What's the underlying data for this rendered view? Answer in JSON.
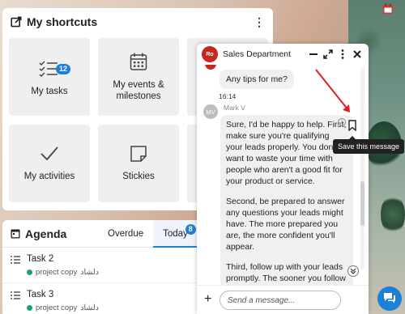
{
  "shortcuts": {
    "title": "My shortcuts",
    "menu": "⋮",
    "tiles": [
      {
        "label": "My tasks",
        "icon": "tasks-checklist-icon",
        "badge": "12"
      },
      {
        "label": "My events &\nmilestones",
        "icon": "calendar-icon"
      },
      {
        "label": "My activities",
        "icon": "checkmark-icon"
      },
      {
        "label": "Stickies",
        "icon": "sticky-note-icon"
      }
    ]
  },
  "agenda": {
    "title": "Agenda",
    "tabs": [
      {
        "label": "Overdue"
      },
      {
        "label": "Today",
        "badge": "8"
      }
    ],
    "items": [
      {
        "name": "Task 2",
        "project": "project copy",
        "owner": "دلشاد"
      },
      {
        "name": "Task 3",
        "project": "project copy",
        "owner": "دلشاد"
      }
    ]
  },
  "chat": {
    "title": "Sales Department",
    "avatar": "Ro",
    "my_message": "Any tips for me?",
    "time": "16:14",
    "sender": "Mark V",
    "sender_initials": "MV",
    "reply_p1": "Sure, I'd be happy to help. First, make sure you're qualifying your leads properly. You don't want to waste your time with people who aren't a good fit for your product or service.",
    "reply_p2": "Second, be prepared to answer any questions your leads might have. The more prepared you are, the more confident you'll appear.",
    "reply_p3": "Third, follow up with your leads promptly. The sooner you follow up, the more likely you are to close the deal.",
    "input_placeholder": "Send a message..."
  },
  "tooltip": "Save this message",
  "colors": {
    "accent": "#1e7fd6",
    "arrow": "#e02020",
    "avatar": "#c9261f"
  }
}
